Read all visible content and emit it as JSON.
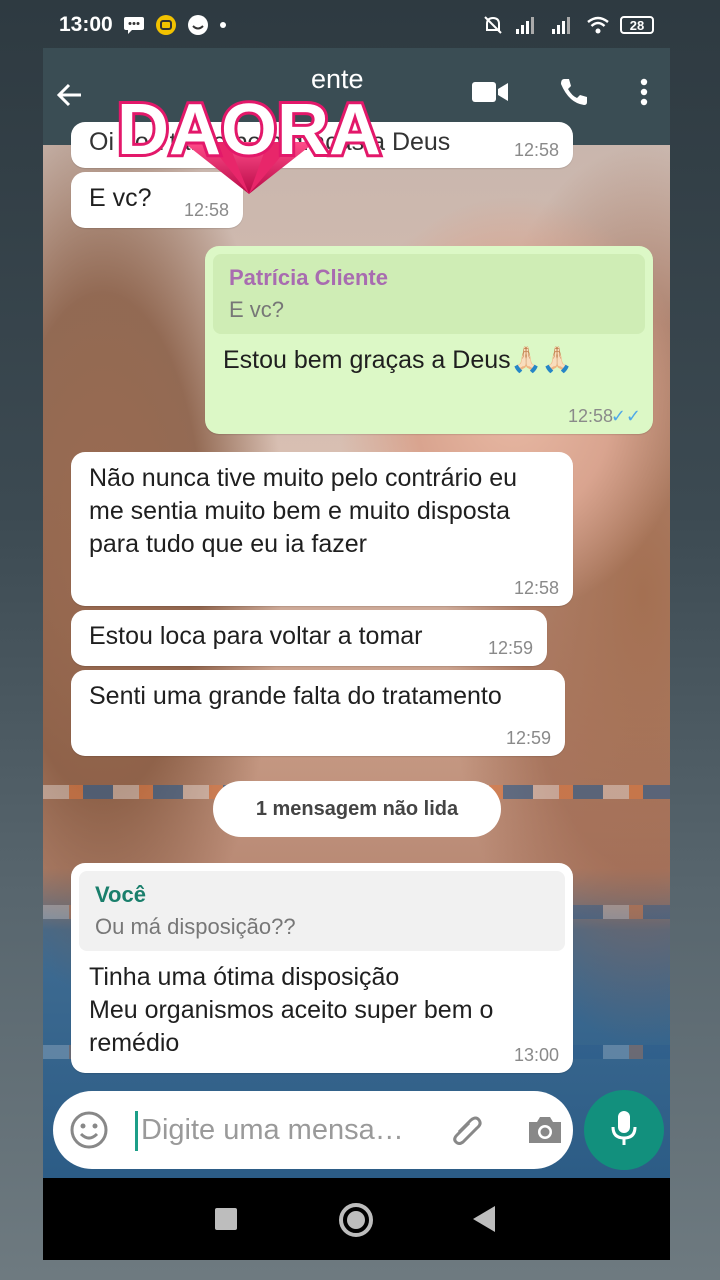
{
  "status": {
    "time": "13:00",
    "battery": "28"
  },
  "header": {
    "contact_name_visible": "ente"
  },
  "logo": {
    "text": "DAORA"
  },
  "messages": [
    {
      "text": "Oi boa tarde bem graças a Deus",
      "time": "12:58",
      "direction": "in"
    },
    {
      "text": "E vc?",
      "time": "12:58",
      "direction": "in"
    },
    {
      "quote_author": "Patrícia Cliente",
      "quote_text": "E vc?",
      "text": "Estou bem graças a Deus🙏🏻🙏🏻",
      "time": "12:58",
      "direction": "out",
      "ticks": "✓✓"
    },
    {
      "text": "Não nunca tive muito pelo contrário eu me sentia muito bem e muito disposta para tudo que eu ia fazer",
      "time": "12:58",
      "direction": "in"
    },
    {
      "text": "Estou loca para voltar a tomar",
      "time": "12:59",
      "direction": "in"
    },
    {
      "text": "Senti uma grande falta do tratamento",
      "time": "12:59",
      "direction": "in"
    },
    {
      "quote_author": "Você",
      "quote_text": "Ou má disposição??",
      "text": "Tinha uma ótima disposição\nMeu organismos aceito super bem o remédio",
      "time": "13:00",
      "direction": "in"
    }
  ],
  "unread_label": "1 mensagem não lida",
  "composer": {
    "placeholder": "Digite uma mensa…"
  },
  "colors": {
    "header": "#3a4d54",
    "outgoing_bubble": "#dcf8c6",
    "accent": "#12907d",
    "quote_author_out": "#a86cb0",
    "quote_author_in": "#1a7f6c"
  }
}
